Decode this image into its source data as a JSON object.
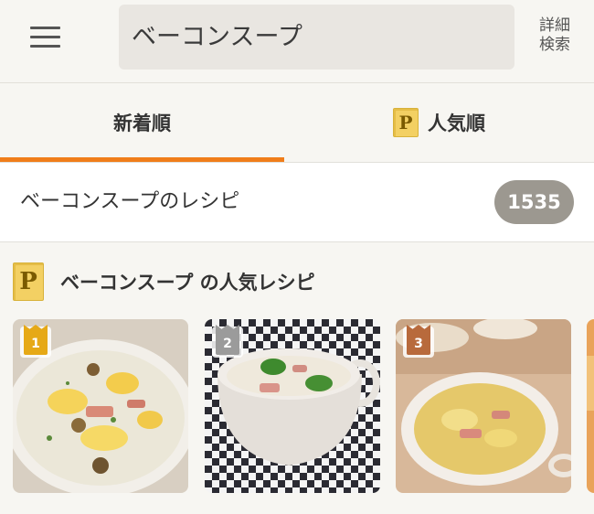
{
  "header": {
    "search_query": "ベーコンスープ",
    "advanced_search_line1": "詳細",
    "advanced_search_line2": "検索"
  },
  "tabs": [
    {
      "label": "新着順",
      "active": true
    },
    {
      "label": "人気順",
      "badge": "P",
      "active": false
    }
  ],
  "results": {
    "label": "ベーコンスープのレシピ",
    "count": "1535"
  },
  "popular": {
    "badge": "P",
    "title": "ベーコンスープ の人気レシピ",
    "recipes": [
      {
        "rank": "1",
        "rank_color": "#e6a917"
      },
      {
        "rank": "2",
        "rank_color": "#9b9b9b"
      },
      {
        "rank": "3",
        "rank_color": "#b86a3c"
      }
    ]
  },
  "colors": {
    "accent": "#f07d1a",
    "premium": "#f3d063",
    "count_badge": "#9c9890"
  }
}
